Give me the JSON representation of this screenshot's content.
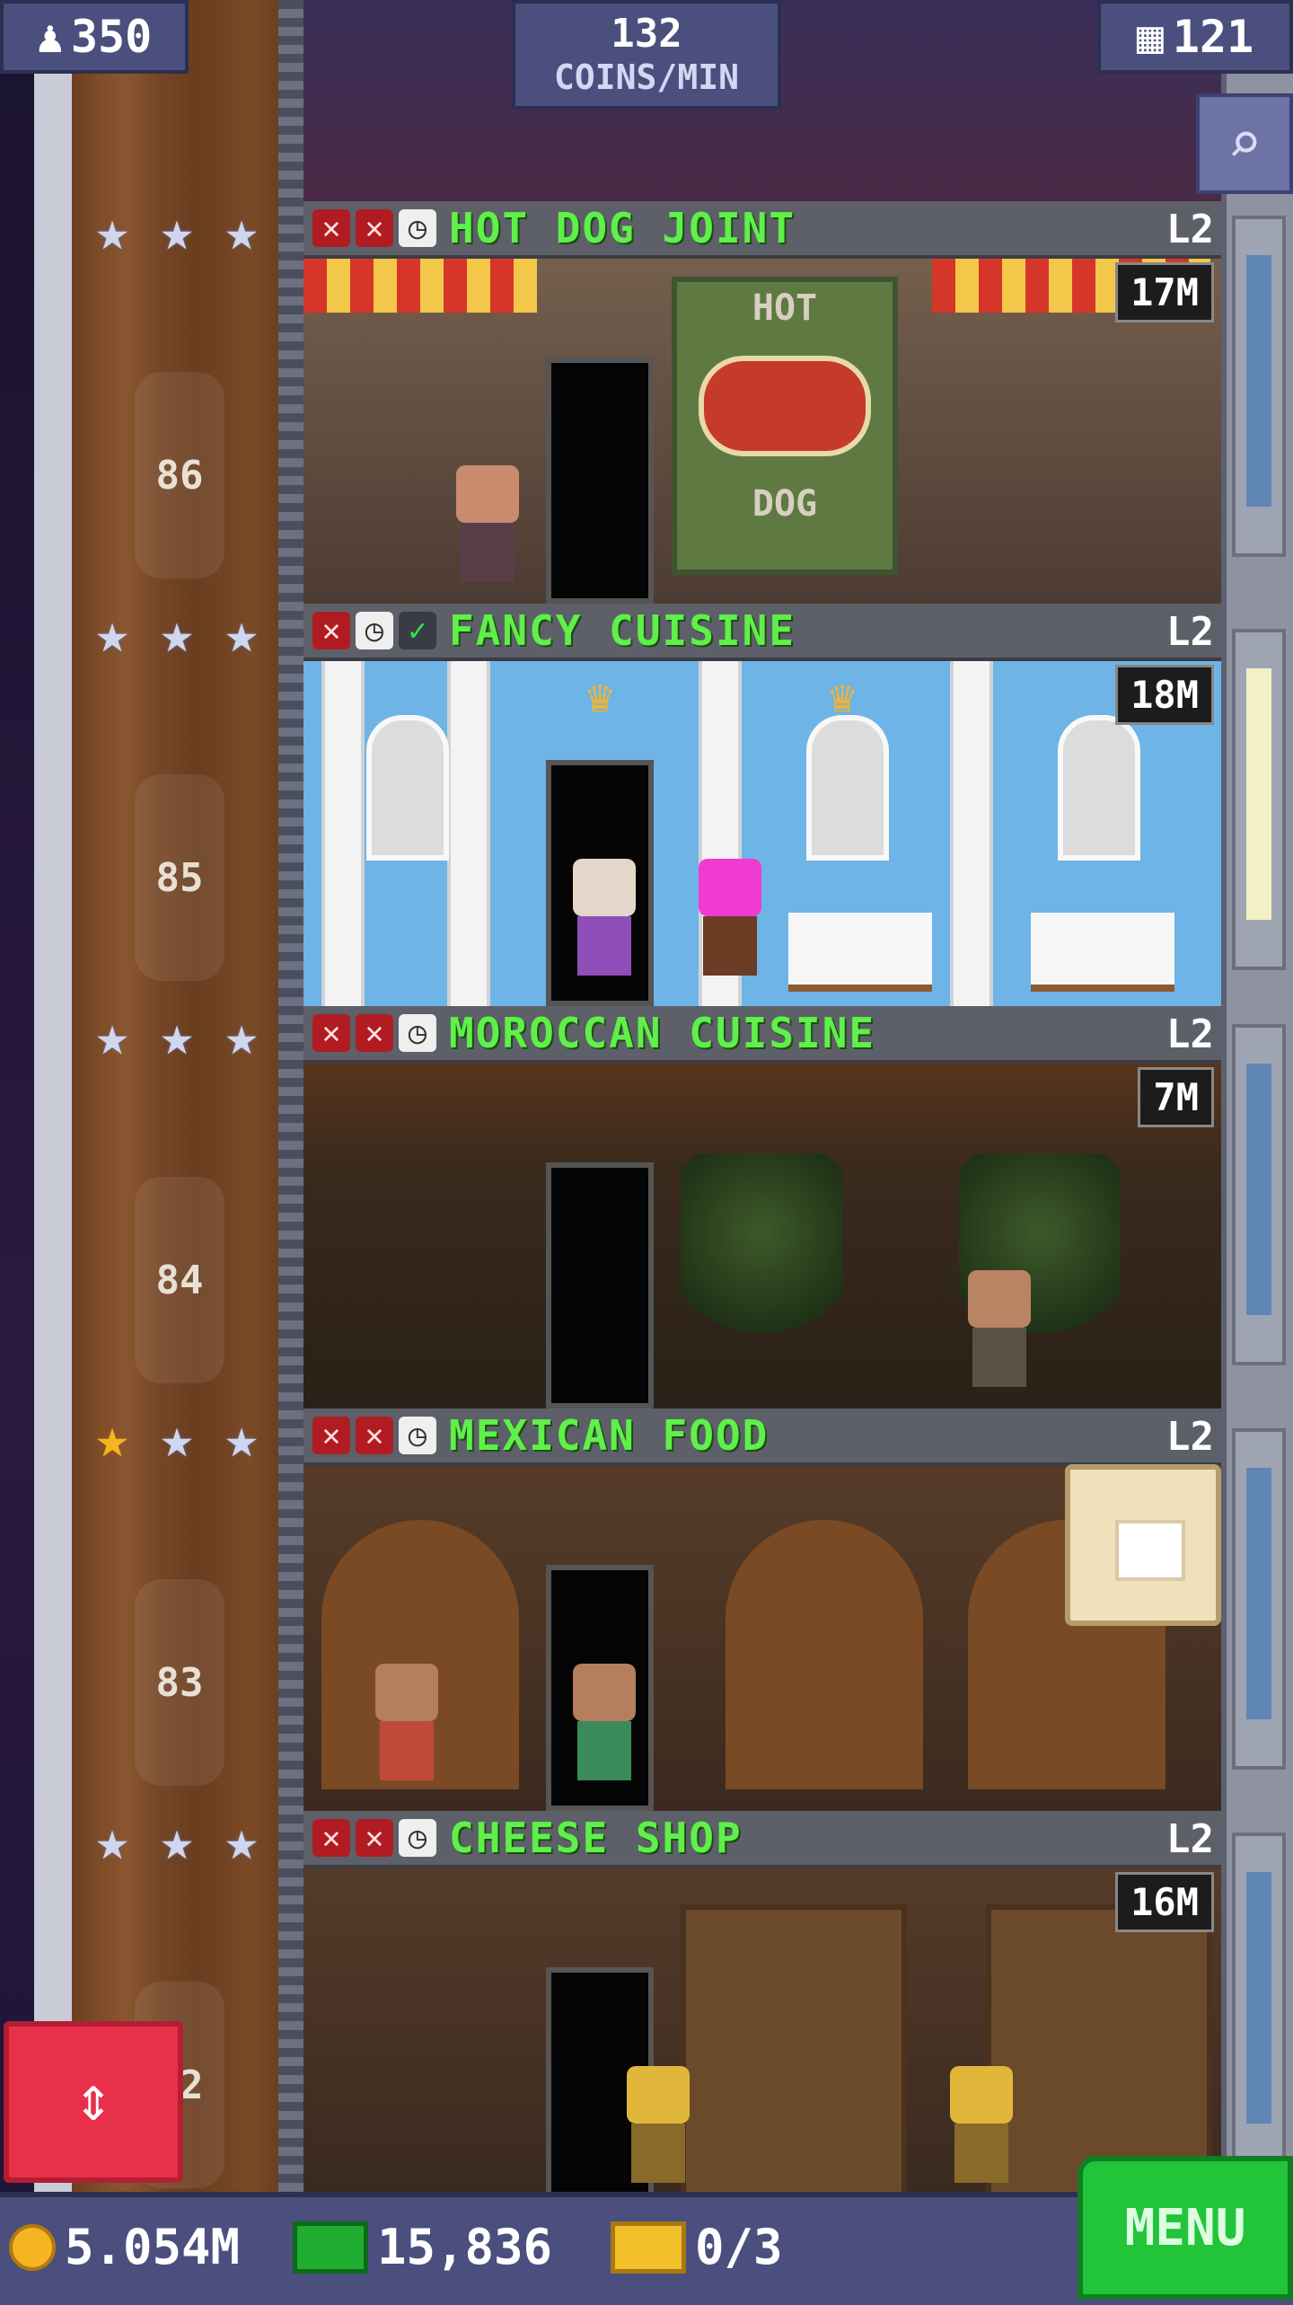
{
  "hud": {
    "population": "350",
    "coins_per_min_value": "132",
    "coins_per_min_label": "COINS/MIN",
    "floor_count": "121"
  },
  "floors": [
    {
      "number": "86",
      "name": "HOT DOG JOINT",
      "level": "L2",
      "timer": "17M",
      "statuses": [
        "x",
        "x",
        "clock"
      ],
      "stars": [
        "silver",
        "silver",
        "silver"
      ]
    },
    {
      "number": "85",
      "name": "FANCY CUISINE",
      "level": "L2",
      "timer": "18M",
      "statuses": [
        "x",
        "clock",
        "check"
      ],
      "stars": [
        "silver",
        "silver",
        "silver"
      ]
    },
    {
      "number": "84",
      "name": "MOROCCAN CUISINE",
      "level": "L2",
      "timer": "7M",
      "statuses": [
        "x",
        "x",
        "clock"
      ],
      "stars": [
        "silver",
        "silver",
        "silver"
      ]
    },
    {
      "number": "83",
      "name": "MEXICAN FOOD",
      "level": "L2",
      "timer": "",
      "statuses": [
        "x",
        "x",
        "clock"
      ],
      "stars": [
        "gold",
        "silver",
        "silver"
      ]
    },
    {
      "number": "82",
      "name": "CHEESE SHOP",
      "level": "L2",
      "timer": "16M",
      "statuses": [
        "x",
        "x",
        "clock"
      ],
      "stars": [
        "silver",
        "silver",
        "silver"
      ]
    }
  ],
  "signs": {
    "hotdog_top": "HOT",
    "hotdog_bottom": "DOG"
  },
  "bottom": {
    "coins": "5.054M",
    "bux": "15,836",
    "tickets": "0/3",
    "menu_label": "MENU"
  },
  "icons": {
    "population": "person-icon",
    "floors": "building-icon",
    "zoom": "magnifier-icon",
    "elevator": "up-down-arrows-icon"
  },
  "colors": {
    "floor_name": "#5ff04a",
    "hud_bg": "#4a4f7e",
    "menu_bg": "#22c43a",
    "elevator_button": "#e8304a",
    "gold_star": "#f5b522"
  }
}
